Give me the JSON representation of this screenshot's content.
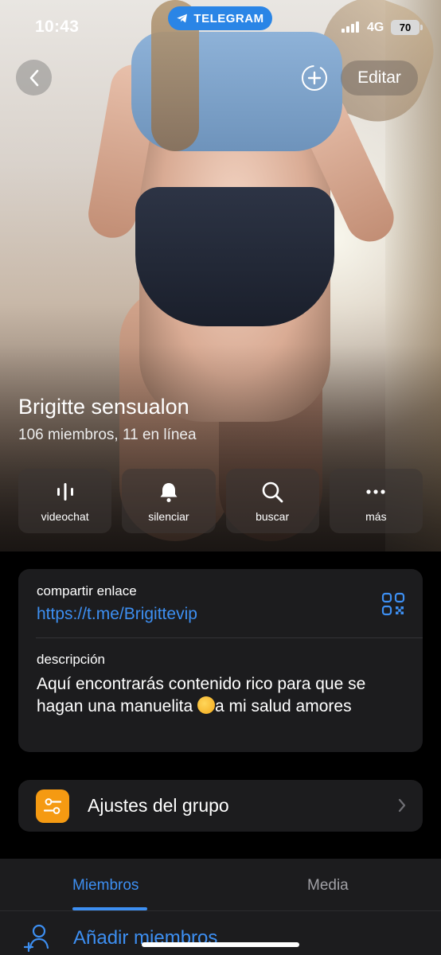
{
  "status_bar": {
    "time": "10:43",
    "app_pill": "TELEGRAM",
    "network": "4G",
    "battery": "70"
  },
  "nav": {
    "edit_label": "Editar"
  },
  "group": {
    "name": "Brigitte sensualon",
    "subtitle": "106 miembros, 11 en línea"
  },
  "actions": [
    {
      "label": "videochat",
      "icon": "videochat-icon"
    },
    {
      "label": "silenciar",
      "icon": "bell-icon"
    },
    {
      "label": "buscar",
      "icon": "search-icon"
    },
    {
      "label": "más",
      "icon": "more-icon"
    }
  ],
  "info": {
    "share_label": "compartir enlace",
    "share_link": "https://t.me/Brigittevip",
    "description_label": "descripción",
    "description_part1": "Aquí encontrarás contenido rico para que se hagan una manuelita ",
    "description_part2": "a mi salud amores"
  },
  "settings": {
    "label": "Ajustes del grupo"
  },
  "tabs": {
    "members": "Miembros",
    "media": "Media"
  },
  "members": {
    "add_label": "Añadir miembros"
  },
  "colors": {
    "accent": "#3d8ff2",
    "telegram": "#2a85e6",
    "settings_icon": "#f59a12",
    "card": "#1c1c1e"
  }
}
